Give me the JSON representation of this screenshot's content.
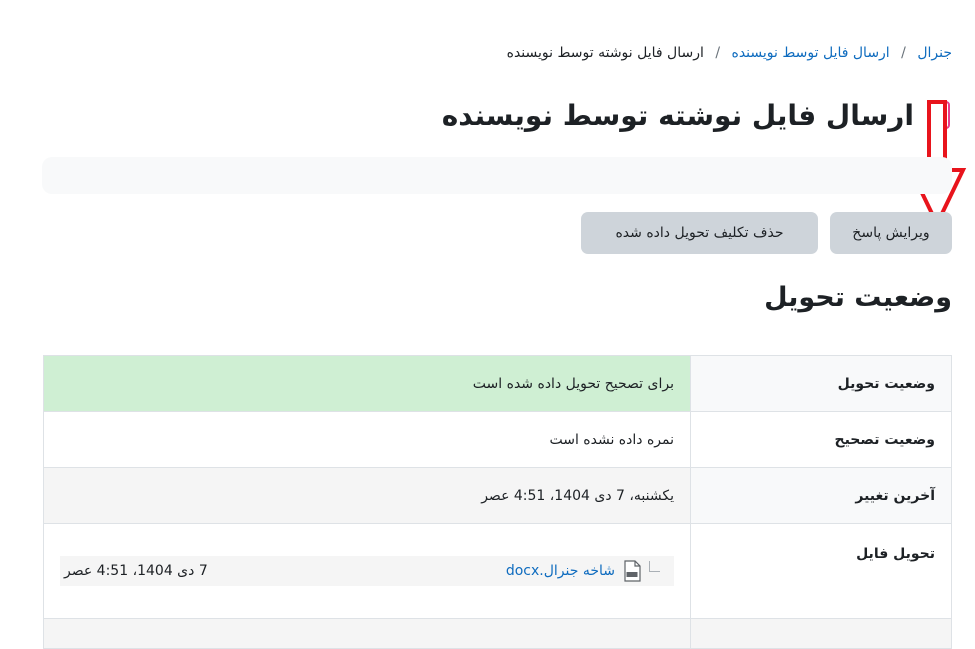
{
  "breadcrumb": {
    "items": [
      "جنرال",
      "ارسال فایل توسط نویسنده"
    ],
    "current": "ارسال فایل نوشته توسط نویسنده",
    "separator": "/"
  },
  "page": {
    "title": "ارسال فایل نوشته توسط نویسنده",
    "icon": "assignment-icon"
  },
  "annotation": {
    "icon": "red-arrow-down-icon",
    "color": "#e8141c"
  },
  "actions": {
    "edit_label": "ویرایش پاسخ",
    "remove_label": "حذف تکلیف تحویل داده شده"
  },
  "submission": {
    "heading": "وضعیت تحویل",
    "rows": [
      {
        "label": "وضعیت تحویل",
        "value": "برای تصحیح تحویل داده شده است"
      },
      {
        "label": "وضعیت تصحیح",
        "value": "نمره داده نشده است"
      },
      {
        "label": "آخرین تغییر",
        "value": "یکشنبه، 7 دی 1404، 4:51 عصر"
      },
      {
        "label": "تحویل فایل"
      }
    ],
    "file": {
      "name": "شاخه جنرال.docx",
      "date": "7 دی 1404، 4:51 عصر",
      "icon": "doc-file-icon"
    }
  },
  "colors": {
    "accent": "#0f6cbf",
    "success_bg": "#cfefd3",
    "button_bg": "#ced4da"
  }
}
